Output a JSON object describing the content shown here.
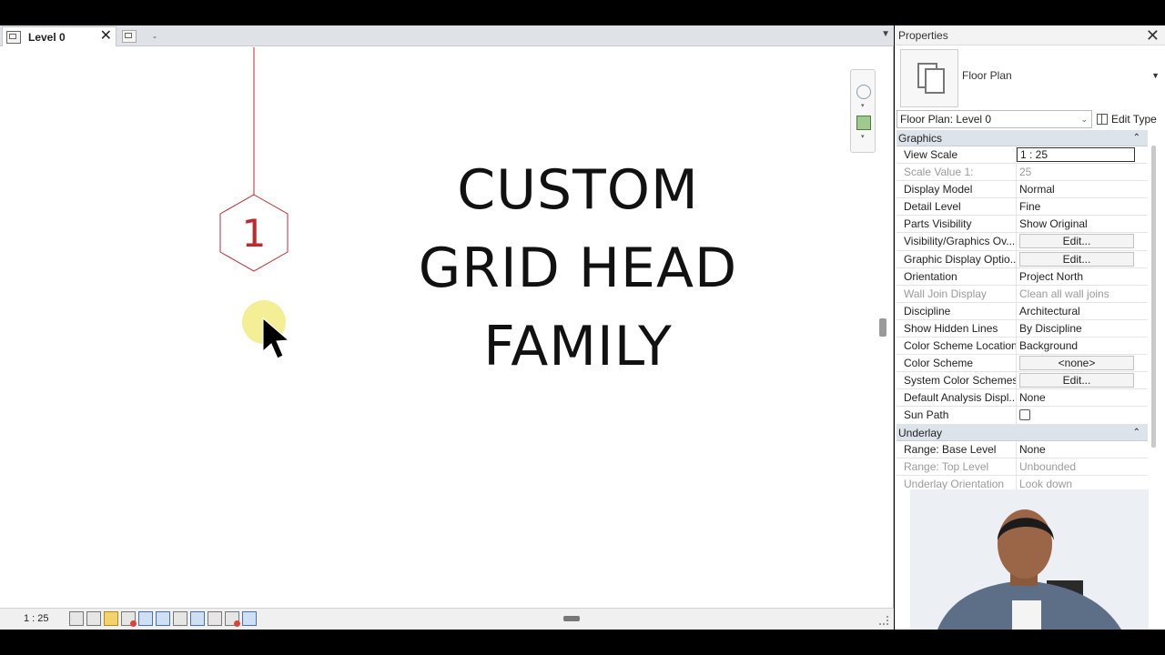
{
  "view": {
    "tabs": [
      {
        "label": "Level 0",
        "active": true
      },
      {
        "label": "-",
        "active": false
      }
    ],
    "grid_head_number": "1",
    "title_lines": [
      "CUSTOM",
      "GRID HEAD",
      "FAMILY"
    ],
    "status_scale": "1 : 25"
  },
  "properties": {
    "title": "Properties",
    "type_name": "Floor Plan",
    "instance_selector": "Floor Plan: Level 0",
    "edit_type_label": "Edit Type",
    "sections": [
      {
        "name": "Graphics",
        "rows": [
          {
            "name": "View Scale",
            "value": "1 : 25",
            "style": "boxed"
          },
          {
            "name": "Scale Value    1:",
            "value": "25",
            "style": "disabled"
          },
          {
            "name": "Display Model",
            "value": "Normal"
          },
          {
            "name": "Detail Level",
            "value": "Fine"
          },
          {
            "name": "Parts Visibility",
            "value": "Show Original"
          },
          {
            "name": "Visibility/Graphics Ov...",
            "value": "Edit...",
            "style": "button"
          },
          {
            "name": "Graphic Display Optio...",
            "value": "Edit...",
            "style": "button"
          },
          {
            "name": "Orientation",
            "value": "Project North"
          },
          {
            "name": "Wall Join Display",
            "value": "Clean all wall joins",
            "style": "disabled"
          },
          {
            "name": "Discipline",
            "value": "Architectural"
          },
          {
            "name": "Show Hidden Lines",
            "value": "By Discipline"
          },
          {
            "name": "Color Scheme Location",
            "value": "Background"
          },
          {
            "name": "Color Scheme",
            "value": "<none>",
            "style": "button"
          },
          {
            "name": "System Color Schemes",
            "value": "Edit...",
            "style": "button"
          },
          {
            "name": "Default Analysis Displ...",
            "value": "None"
          },
          {
            "name": "Sun Path",
            "value": "",
            "style": "checkbox"
          }
        ]
      },
      {
        "name": "Underlay",
        "rows": [
          {
            "name": "Range: Base Level",
            "value": "None"
          },
          {
            "name": "Range: Top Level",
            "value": "Unbounded",
            "style": "disabled"
          },
          {
            "name": "Underlay Orientation",
            "value": "Look down",
            "style": "disabled"
          }
        ]
      }
    ]
  },
  "colors": {
    "grid_red": "#c0282c",
    "highlight_yellow": "#f3ec8c",
    "section_bg": "#dde3ea"
  },
  "icons": {
    "status_tools": [
      "detail-level-icon",
      "visual-style-icon",
      "sun-path-icon",
      "shadows-icon",
      "crop-view-icon",
      "show-crop-icon",
      "temporary-hide-icon",
      "reveal-hidden-icon",
      "lock-3d-icon",
      "worksharing-icon",
      "analysis-display-icon"
    ]
  }
}
